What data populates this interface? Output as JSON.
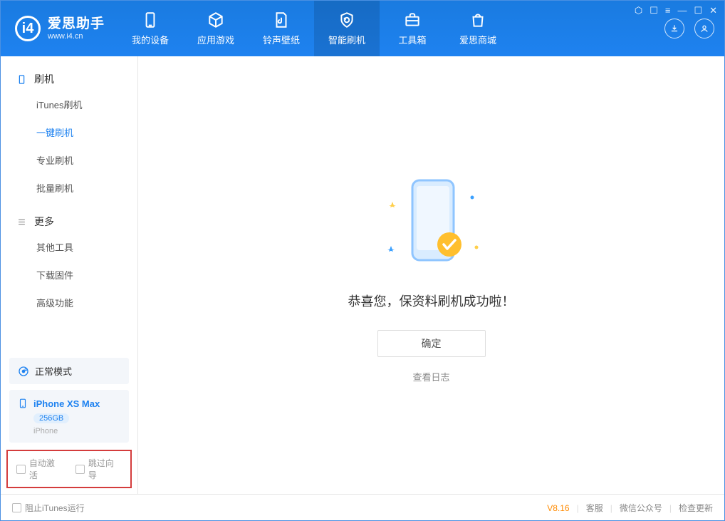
{
  "app": {
    "name_cn": "爱思助手",
    "name_en": "www.i4.cn"
  },
  "nav": [
    {
      "label": "我的设备"
    },
    {
      "label": "应用游戏"
    },
    {
      "label": "铃声壁纸"
    },
    {
      "label": "智能刷机",
      "active": true
    },
    {
      "label": "工具箱"
    },
    {
      "label": "爱思商城"
    }
  ],
  "sidebar": {
    "section1": {
      "title": "刷机",
      "items": [
        "iTunes刷机",
        "一键刷机",
        "专业刷机",
        "批量刷机"
      ],
      "activeIndex": 1
    },
    "section2": {
      "title": "更多",
      "items": [
        "其他工具",
        "下载固件",
        "高级功能"
      ]
    }
  },
  "device": {
    "mode": "正常模式",
    "name": "iPhone XS Max",
    "storage": "256GB",
    "type": "iPhone"
  },
  "options": {
    "auto_activate": "自动激活",
    "skip_guide": "跳过向导"
  },
  "main": {
    "success_msg": "恭喜您，保资料刷机成功啦！",
    "ok": "确定",
    "view_log": "查看日志"
  },
  "footer": {
    "block_itunes": "阻止iTunes运行",
    "version": "V8.16",
    "links": [
      "客服",
      "微信公众号",
      "检查更新"
    ]
  }
}
